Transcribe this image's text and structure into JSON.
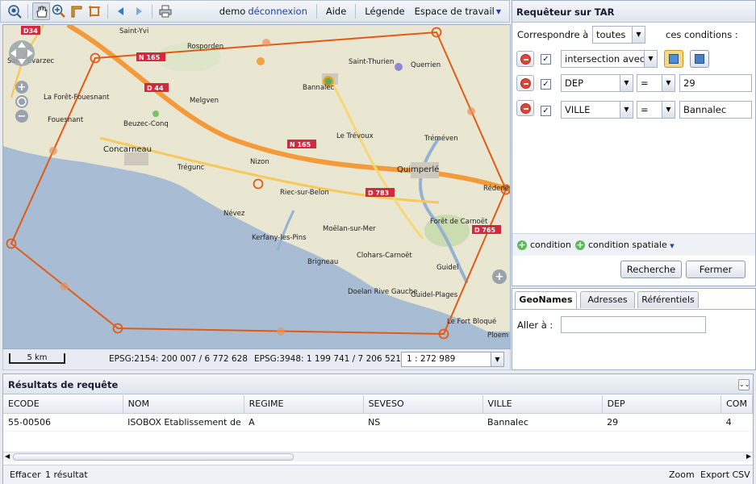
{
  "toolbar": {
    "user": "demo",
    "logout": "déconnexion",
    "help": "Aide",
    "legend": "Légende",
    "workspace": "Espace de travail"
  },
  "map": {
    "places": [
      "Saint-Yvi",
      "Rosporden",
      "Saint-Évarzec",
      "La Forêt-Fouesnant",
      "Fouesnant",
      "Beuzec-Conq",
      "Concarneau",
      "Melgven",
      "Bannalec",
      "Saint-Thurien",
      "Querrien",
      "Le Trévoux",
      "Tréméven",
      "Trégunc",
      "Nizon",
      "Quimperlé",
      "Rédené",
      "Riec-sur-Belon",
      "Névez",
      "Kerfany-les-Pins",
      "Moëlan-sur-Mer",
      "Forêt de Carnoët",
      "Brigneau",
      "Clohars-Carnoët",
      "Doelan Rive Gauche",
      "Guidel",
      "Guidel-Plages",
      "Le Fort Bloqué",
      "Ploem"
    ],
    "roads": [
      "D34",
      "N 165",
      "D 44",
      "N 165",
      "D 783",
      "D 765"
    ],
    "scale_label": "5 km",
    "epsg2154": "EPSG:2154: 200 007 / 6 772 628",
    "epsg3948": "EPSG:3948: 1 199 741 / 7 206 521",
    "zoom_value": "1 : 272 989"
  },
  "query_panel": {
    "title": "Requêteur sur TAR",
    "match_label": "Correspondre à",
    "match_value": "toutes",
    "match_suffix": "ces conditions :",
    "conditions": [
      {
        "field": "intersection avec",
        "operator": "",
        "value": ""
      },
      {
        "field": "DEP",
        "operator": "=",
        "value": "29"
      },
      {
        "field": "VILLE",
        "operator": "=",
        "value": "Bannalec"
      }
    ],
    "add_condition": "condition",
    "add_spatial": "condition spatiale",
    "search_btn": "Recherche",
    "close_btn": "Fermer"
  },
  "geo_panel": {
    "tabs": [
      "GeoNames",
      "Adresses",
      "Référentiels"
    ],
    "goto_label": "Aller à :",
    "goto_value": ""
  },
  "results": {
    "title": "Résultats de requête",
    "columns": [
      "ECODE",
      "NOM",
      "REGIME",
      "SEVESO",
      "VILLE",
      "DEP",
      "COM"
    ],
    "rows": [
      [
        "55-00506",
        "ISOBOX Etablissement de Bar",
        "A",
        "NS",
        "Bannalec",
        "29",
        "4"
      ]
    ],
    "clear": "Effacer",
    "count": "1 résultat",
    "zoom": "Zoom",
    "export": "Export CSV"
  }
}
